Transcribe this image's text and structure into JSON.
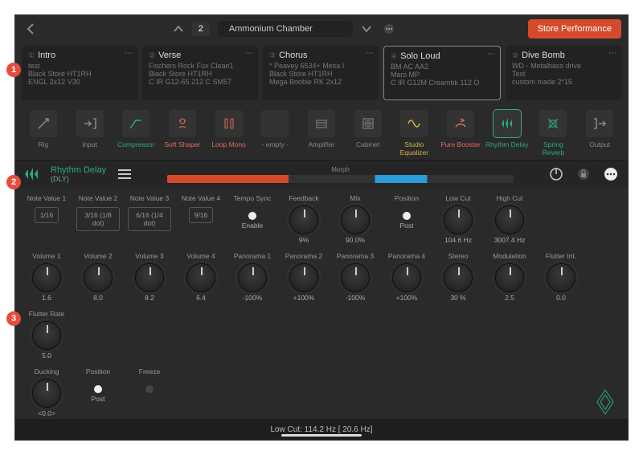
{
  "header": {
    "perf_number": "2",
    "perf_name": "Ammonium Chamber",
    "store_label": "Store Performance"
  },
  "slots": [
    {
      "num": "①",
      "title": "Intro",
      "line1": "test",
      "line2": "Black Store HT1RH",
      "line3": "ENGL 2x12 V30"
    },
    {
      "num": "②",
      "title": "Verse",
      "line1": "Fischers Rock Fux Clean1",
      "line2": "Black Store HT1RH",
      "line3": "C IR G12-65 212 C SM57"
    },
    {
      "num": "③",
      "title": "Chorus",
      "line1": "* Peavey 6534+ Mesa I",
      "line2": "Black Store HT1RH",
      "line3": "Mega Boobie RK 2x12"
    },
    {
      "num": "④",
      "title": "Solo Loud",
      "line1": "BM AC AA2",
      "line2": "Mars MP",
      "line3": "C IR G12M Creambk 112 O"
    },
    {
      "num": "⑤",
      "title": "Dive Bomb",
      "line1": "WD - Metalbass drive",
      "line2": "Test",
      "line3": "custom made 2*15"
    }
  ],
  "chain": [
    {
      "label": "Rig",
      "color": ""
    },
    {
      "label": "Input",
      "color": ""
    },
    {
      "label": "Compressor",
      "color": "grn"
    },
    {
      "label": "Soft Shaper",
      "color": "red"
    },
    {
      "label": "Loop Mono",
      "color": "red"
    },
    {
      "label": "- empty -",
      "color": ""
    },
    {
      "label": "Amplifier",
      "color": ""
    },
    {
      "label": "Cabinet",
      "color": ""
    },
    {
      "label": "Studio Equalizer",
      "color": "yel"
    },
    {
      "label": "Pure Booster",
      "color": "red"
    },
    {
      "label": "Rhythm Delay",
      "color": "grn",
      "selected": true
    },
    {
      "label": "Spring Reverb",
      "color": "grn"
    },
    {
      "label": "Output",
      "color": ""
    }
  ],
  "effect": {
    "title": "Rhythm Delay",
    "subtitle": "(DLY)",
    "morph_label": "Morph"
  },
  "params": {
    "row1": [
      {
        "type": "seg",
        "label": "Note Value 1",
        "value": "1/16"
      },
      {
        "type": "seg",
        "label": "Note Value 2",
        "value": "3/16 (1/8 dot)"
      },
      {
        "type": "seg",
        "label": "Note Value 3",
        "value": "6/16 (1/4 dot)"
      },
      {
        "type": "seg",
        "label": "Note Value 4",
        "value": "9/16"
      },
      {
        "type": "dot",
        "label": "Tempo Sync",
        "value": "Enable"
      },
      {
        "type": "knob",
        "label": "Feedback",
        "value": "9%"
      },
      {
        "type": "knob",
        "label": "Mix",
        "value": "90.0%"
      },
      {
        "type": "dot",
        "label": "Position",
        "value": "Post"
      },
      {
        "type": "knob",
        "label": "Low Cut",
        "value": "104.6 Hz"
      },
      {
        "type": "knob",
        "label": "High Cut",
        "value": "3007.4 Hz"
      }
    ],
    "row2": [
      {
        "type": "knob",
        "label": "Volume 1",
        "value": "1.6"
      },
      {
        "type": "knob",
        "label": "Volume 2",
        "value": "8.0"
      },
      {
        "type": "knob",
        "label": "Volume 3",
        "value": "8.2"
      },
      {
        "type": "knob",
        "label": "Volume 4",
        "value": "6.4"
      },
      {
        "type": "knob",
        "label": "Panorama 1",
        "value": "-100%"
      },
      {
        "type": "knob",
        "label": "Panorama 2",
        "value": "+100%"
      },
      {
        "type": "knob",
        "label": "Panorama 3",
        "value": "-100%"
      },
      {
        "type": "knob",
        "label": "Panorama 4",
        "value": "+100%"
      },
      {
        "type": "knob",
        "label": "Stereo",
        "value": "30 %"
      },
      {
        "type": "knob",
        "label": "Modulation",
        "value": "2.5"
      },
      {
        "type": "knob",
        "label": "Flutter Int.",
        "value": "0.0"
      },
      {
        "type": "knob",
        "label": "Flutter Rate",
        "value": "5.0"
      }
    ],
    "row3": [
      {
        "type": "knob",
        "label": "Ducking",
        "value": "<0.0>"
      },
      {
        "type": "dot",
        "label": "Position",
        "value": "Post"
      },
      {
        "type": "dotoff",
        "label": "Freeze",
        "value": ""
      }
    ]
  },
  "footer": {
    "status": "Low Cut:   114.2 Hz   [ 20.6 Hz]"
  }
}
